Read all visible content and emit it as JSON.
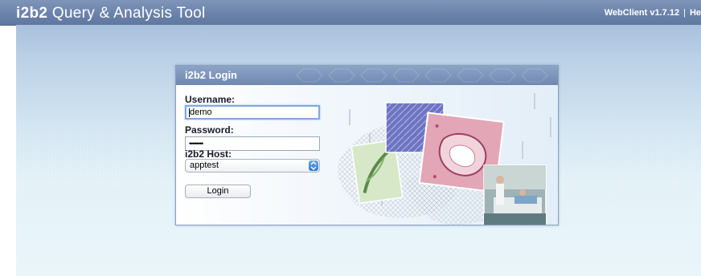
{
  "header": {
    "brand": "i2b2",
    "app_name": "Query & Analysis Tool",
    "version_label": "WebClient v1.7.12",
    "separator": "|",
    "help_link": "He"
  },
  "login": {
    "title": "i2b2 Login",
    "username_label": "Username:",
    "username_value": "demo",
    "password_label": "Password:",
    "password_value": "••••••••",
    "host_label": "i2b2 Host:",
    "host_selected": "apptest",
    "login_button": "Login"
  },
  "colors": {
    "header_bg": "#6b83aa",
    "panel_title_bg": "#7a91b8",
    "page_bg": "#d4e6f2",
    "select_arrow": "#2f78d8"
  },
  "icons": {
    "select_arrow": "chevron-updown-icon"
  }
}
